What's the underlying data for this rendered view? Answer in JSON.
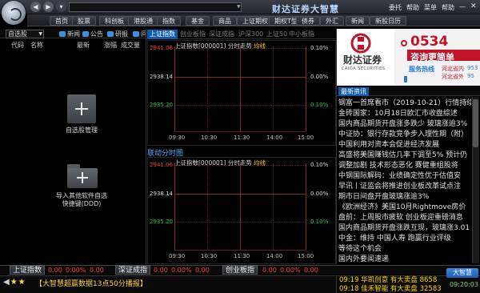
{
  "title_bar": {
    "app_title": "财达证券大智慧",
    "links": [
      "委托",
      "帮助",
      "菜单",
      "帮助"
    ]
  },
  "menu": [
    "首页",
    "股票",
    "科创板",
    "港股通",
    "指数",
    "基金",
    "商品",
    "上证期权",
    "期权T型报价",
    "债券",
    "外汇",
    "新闻",
    "新股日历"
  ],
  "left_panel": {
    "select_value": "自选股",
    "tabs": [
      "新闻",
      "公告",
      "研报",
      "问答"
    ],
    "columns": [
      "代码",
      "名称",
      "最新",
      "涨幅",
      "成交量"
    ],
    "manage_label": "自选股管理",
    "import_label": "导入其他软件自选\n快捷键(DDD)"
  },
  "mid_panel": {
    "tabs": [
      "上证指数",
      "创业板指",
      "深证成指",
      "沪深300",
      "上证50",
      "中小板指"
    ],
    "linkage_title": "联动分时图",
    "charts": [
      {
        "title": "上证指数[000001] 分时走势",
        "tag": "均线",
        "y_labels": [
          "2941.06",
          "2938.14",
          "2935.20"
        ],
        "pct_labels": [
          "0.10%",
          "0.00%",
          "0.10%"
        ],
        "x_labels": [
          "09:30",
          "10:30",
          "11:30",
          "14:00",
          "15:00"
        ]
      },
      {
        "title": "上证指数[000001] 分时走势",
        "tag": "均线",
        "y_labels": [
          "2941.06",
          "2938.14",
          "2935.20"
        ],
        "pct_labels": [
          "0.10%",
          "0.00%",
          "0.10%"
        ],
        "x_labels": [
          "09:30",
          "10:30",
          "11:30",
          "14:00",
          "15:00"
        ]
      }
    ]
  },
  "ad": {
    "brand_cn": "财达证券",
    "brand_en": "CAIDA SECURITIES",
    "hotline_big": "0534",
    "consult_label": "咨询更简单",
    "service_label": "服务热线",
    "region_1": "河北省内",
    "region_2": "河北省外",
    "num_1": "953",
    "num_2": "95"
  },
  "news": {
    "tab": "最新资讯",
    "items": [
      "钢富一首席看市（2019-10-21）行情持续",
      "金砖国家：10月18日欧汇市收盘综述",
      "国内商品期货开盘涨多跌少 玻璃涨逾3%",
      "中证协：银行存款竞争步入理性期（附）",
      "中国利用对资本会促进经济发展",
      "高盛将美国赚钱估几率下调至5% 预计仍",
      "调整加剧 技术形态恶化 賽健重组股将",
      "中钢国际解码：业绩确定性优于估值安",
      "早讯丨证监会将推进创业板改革试点注",
      "期市日间盘开盘玻璃涨逾3%",
      "《欧洲经济》美国10月Rightmove房价",
      "盘前：上周股市疲软 创业板迎重磅消息",
      "国内商品期货开盘涨跌互现，玻璃涨3.01",
      "中金：维持 中国人寿 跑赢行业评级",
      "等待这个机会",
      "国内外要闻速递"
    ]
  },
  "index_bar": {
    "items": [
      {
        "name": "上证指数",
        "values": [
          "0.00",
          "0.00%",
          "0.00"
        ]
      },
      {
        "name": "深证成指",
        "values": [
          "0.00",
          "0.00%",
          "0.00"
        ]
      },
      {
        "name": "创业板指",
        "values": [
          "0.00",
          "0.00%",
          "0.00"
        ]
      }
    ]
  },
  "ticker": {
    "text": "【大智慧超赢数据13点50分播报】",
    "alerts": [
      "09:19 华凯创意 有大卖盘 8658",
      "09:18 佳禾智能 有大卖盘 32583"
    ],
    "clock": "09:20:03",
    "logo": "大智慧"
  },
  "colors": {
    "accent_blue": "#0e5aa7",
    "up_red": "#ff3d3d",
    "price_green": "#2fc94a",
    "alert_yellow": "#ffd400"
  }
}
